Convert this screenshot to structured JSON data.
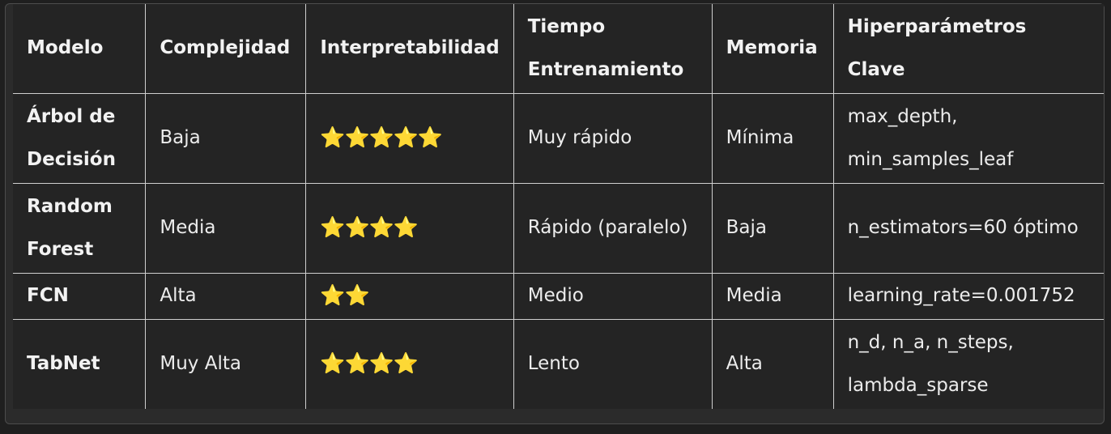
{
  "table": {
    "headers": [
      "Modelo",
      "Complejidad",
      "Interpretabilidad",
      "Tiempo Entrenamiento",
      "Memoria",
      "Hiperparámetros Clave"
    ],
    "rows": [
      {
        "model": "Árbol de Decisión",
        "complexity": "Baja",
        "interpretability": "⭐⭐⭐⭐⭐",
        "interpretability_stars": 5,
        "training_time": "Muy rápido",
        "memory": "Mínima",
        "hyperparameters": "max_depth, min_samples_leaf"
      },
      {
        "model": "Random Forest",
        "complexity": "Media",
        "interpretability": "⭐⭐⭐⭐",
        "interpretability_stars": 4,
        "training_time": "Rápido (paralelo)",
        "memory": "Baja",
        "hyperparameters": "n_estimators=60 óptimo"
      },
      {
        "model": "FCN",
        "complexity": "Alta",
        "interpretability": "⭐⭐",
        "interpretability_stars": 2,
        "training_time": "Medio",
        "memory": "Media",
        "hyperparameters": "learning_rate=0.001752"
      },
      {
        "model": "TabNet",
        "complexity": "Muy Alta",
        "interpretability": "⭐⭐⭐⭐",
        "interpretability_stars": 4,
        "training_time": "Lento",
        "memory": "Alta",
        "hyperparameters": "n_d, n_a, n_steps, lambda_sparse"
      }
    ]
  },
  "colors": {
    "background": "#1f1f1f",
    "table_background": "#242424",
    "text": "#ececec",
    "border": "#cfcfcf",
    "star": "#f5c232"
  }
}
